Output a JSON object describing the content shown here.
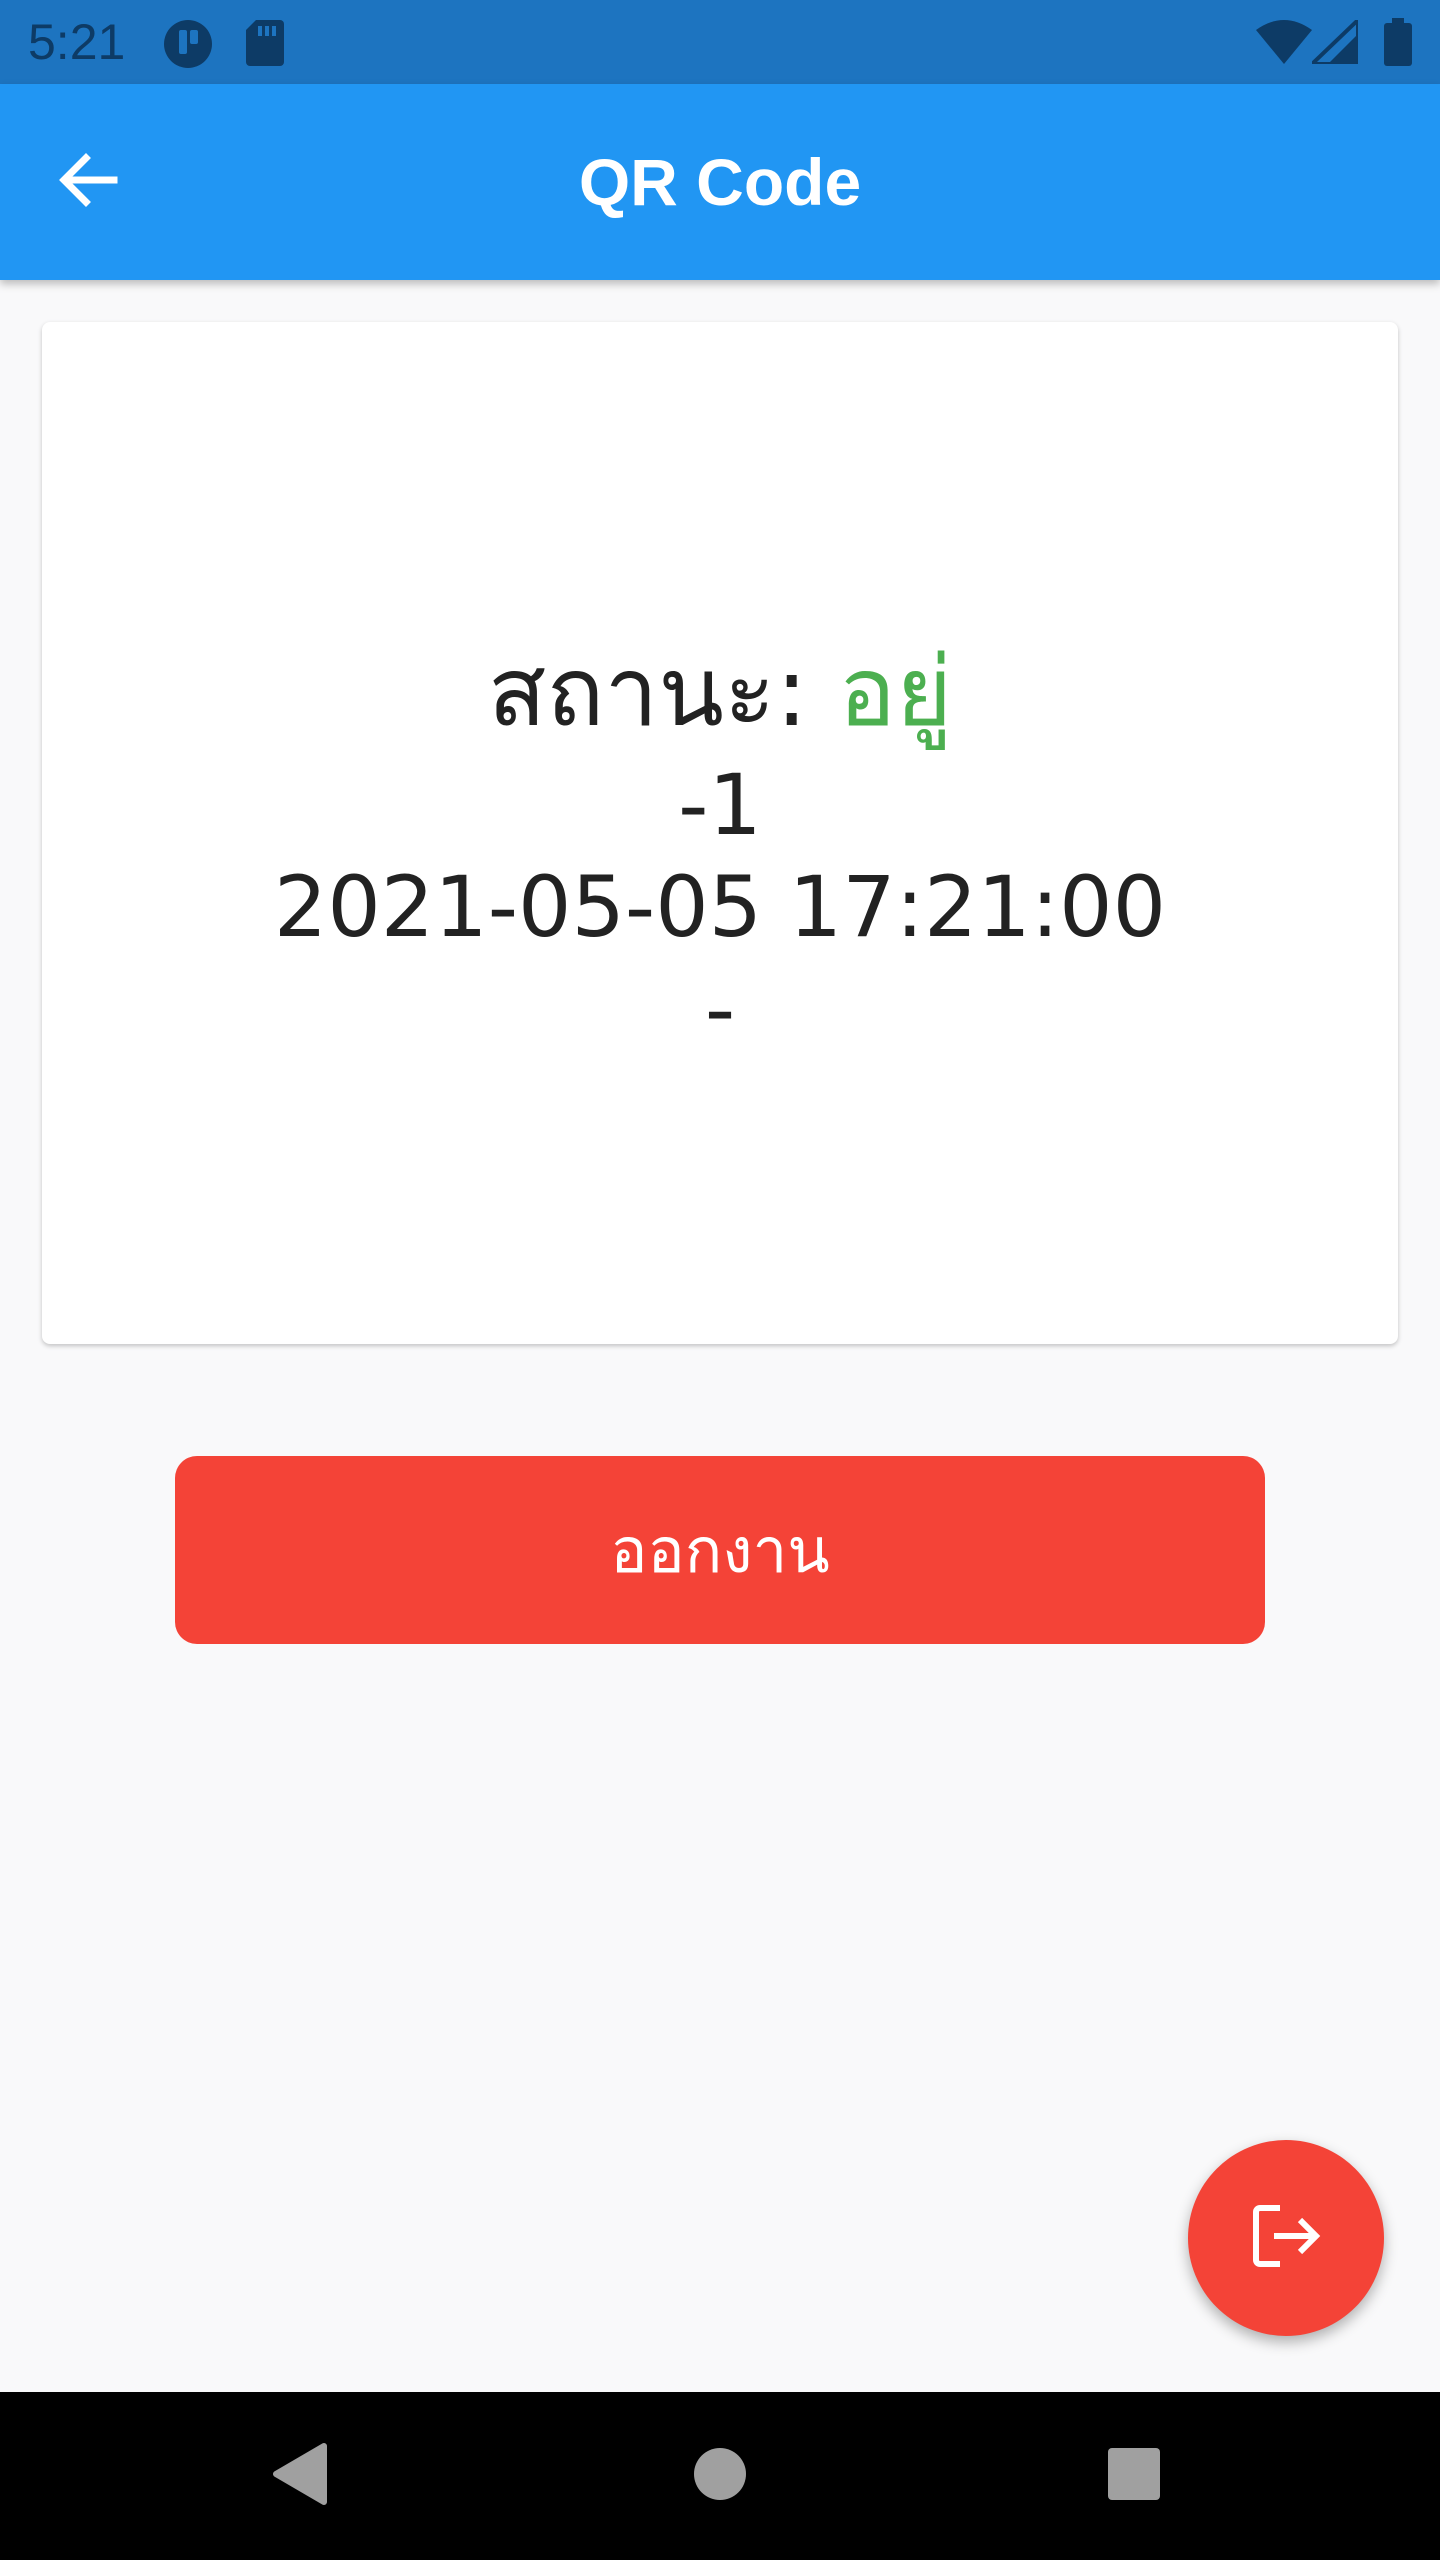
{
  "status_bar": {
    "time": "5:21",
    "icons": [
      "notification-app-icon",
      "sd-card-icon",
      "wifi-icon",
      "cell-signal-icon",
      "battery-icon"
    ]
  },
  "app_bar": {
    "title": "QR Code",
    "back_icon": "arrow-back-icon",
    "background_color": "#2196f3"
  },
  "card": {
    "status_label": "สถานะ: ",
    "status_value": "อยู่",
    "status_value_color": "#4caf50",
    "value": "-1",
    "datetime": "2021-05-05 17:21:00",
    "extra": "-"
  },
  "leave_button": {
    "label": "ออกงาน",
    "color": "#f44337"
  },
  "fab": {
    "icon": "logout-icon",
    "color": "#f44337"
  },
  "nav_bar": {
    "icons": [
      "back-triangle-icon",
      "home-circle-icon",
      "recents-square-icon"
    ]
  }
}
